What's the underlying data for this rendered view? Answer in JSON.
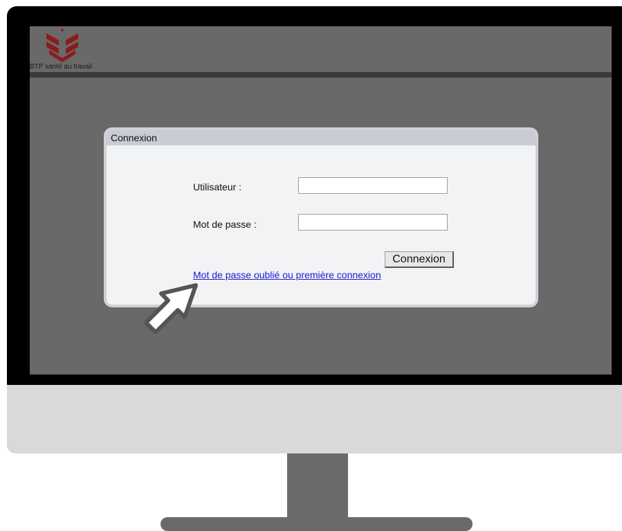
{
  "brand": {
    "text": "BTP santé au travail",
    "color": "#8b1c1c"
  },
  "login": {
    "title": "Connexion",
    "user_label": "Utilisateur :",
    "user_value": "",
    "password_label": "Mot de passe :",
    "password_value": "",
    "submit_label": "Connexion",
    "forgot_link": "Mot de passe oublié ou première connexion"
  },
  "icons": {
    "cursor": "arrow-cursor-icon",
    "logo": "btp-logo-icon"
  }
}
